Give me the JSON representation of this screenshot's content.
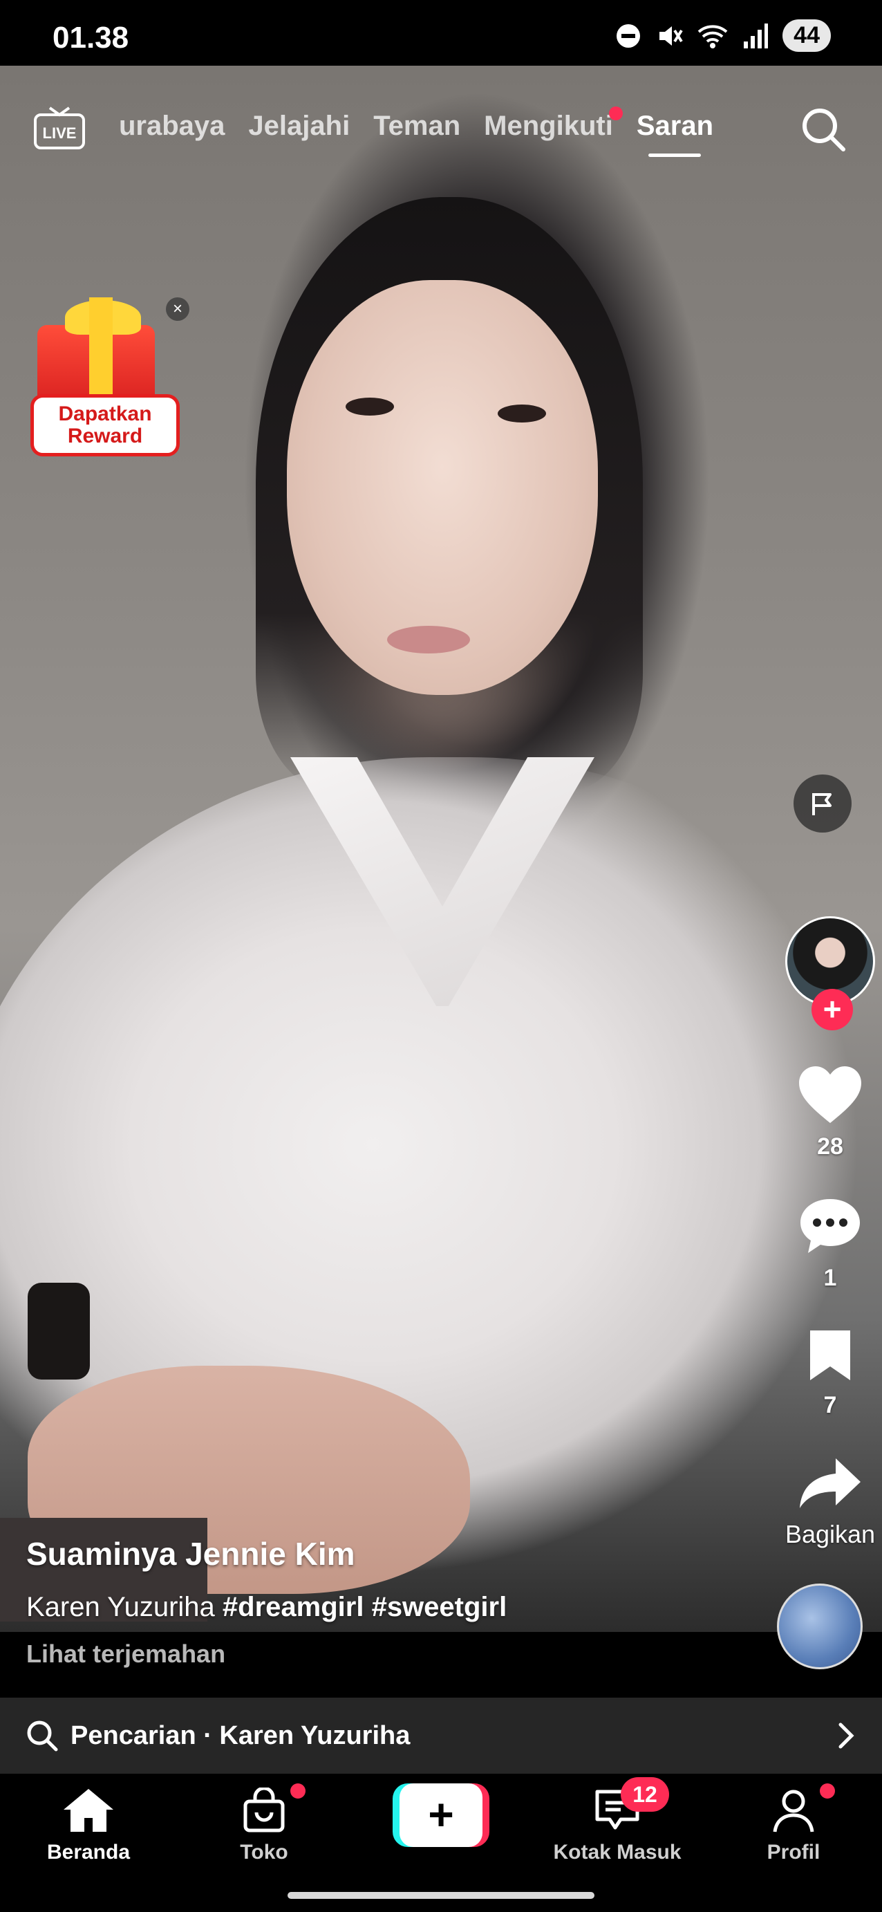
{
  "status_bar": {
    "time": "01.38",
    "battery": "44"
  },
  "top_nav": {
    "live_label": "LIVE",
    "tabs": [
      "urabaya",
      "Jelajahi",
      "Teman",
      "Mengikuti",
      "Saran"
    ],
    "active_tab": "Saran"
  },
  "reward": {
    "label_line1": "Dapatkan",
    "label_line2": "Reward",
    "close": "×"
  },
  "actions": {
    "likes": "28",
    "comments": "1",
    "bookmarks": "7",
    "share_label": "Bagikan",
    "follow": "+"
  },
  "caption": {
    "username": "Suaminya Jennie Kim",
    "desc_prefix": "Karen Yuzuriha",
    "hashtags": "#dreamgirl #sweetgirl",
    "translate": "Lihat terjemahan"
  },
  "search_suggestion": {
    "text": "Pencarian · Karen Yuzuriha"
  },
  "bottom_nav": {
    "home": "Beranda",
    "shop": "Toko",
    "create": "+",
    "inbox": "Kotak Masuk",
    "inbox_badge": "12",
    "profile": "Profil"
  },
  "colors": {
    "accent": "#fe2c55",
    "cyan": "#25f4ee",
    "search_bar_bg": "#262626"
  }
}
